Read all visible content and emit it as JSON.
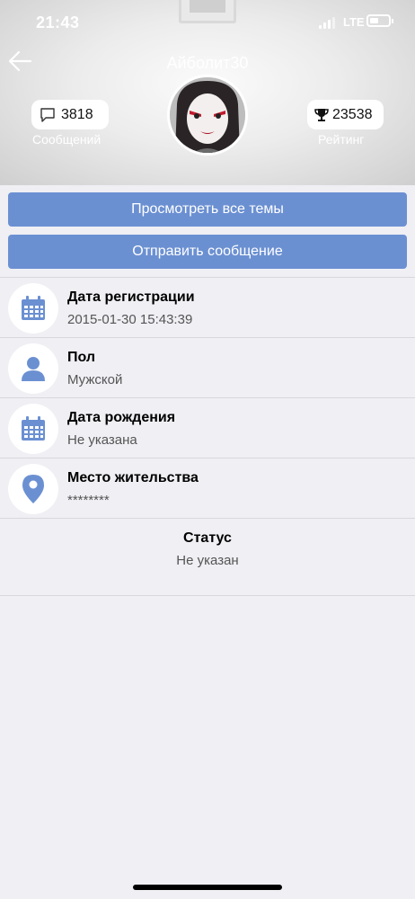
{
  "status_bar": {
    "time": "21:43",
    "network": "LTE",
    "icons": [
      "signal-icon",
      "battery-icon"
    ]
  },
  "header": {
    "back_icon": "back-arrow-icon",
    "username": "Айболит30",
    "avatar_icon": "avatar",
    "messages": {
      "count": "3818",
      "label": "Сообщений",
      "icon": "chat-bubble-icon"
    },
    "rating": {
      "count": "23538",
      "label": "Рейтинг",
      "icon": "trophy-icon"
    }
  },
  "actions": {
    "view_topics": "Просмотреть все темы",
    "send_message": "Отправить сообщение"
  },
  "info": [
    {
      "title": "Дата регистрации",
      "value": "2015-01-30 15:43:39",
      "icon": "calendar-icon"
    },
    {
      "title": "Пол",
      "value": "Мужской",
      "icon": "person-icon"
    },
    {
      "title": "Дата рождения",
      "value": "Не указана",
      "icon": "calendar-icon"
    },
    {
      "title": "Место жительства",
      "value": "********",
      "icon": "location-pin-icon"
    }
  ],
  "status": {
    "title": "Статус",
    "value": "Не указан"
  },
  "colors": {
    "accent": "#6b90d2",
    "background": "#efeff4",
    "header_gradient_center": "#fbfbfb",
    "header_gradient_edge": "#cfcfcf"
  }
}
